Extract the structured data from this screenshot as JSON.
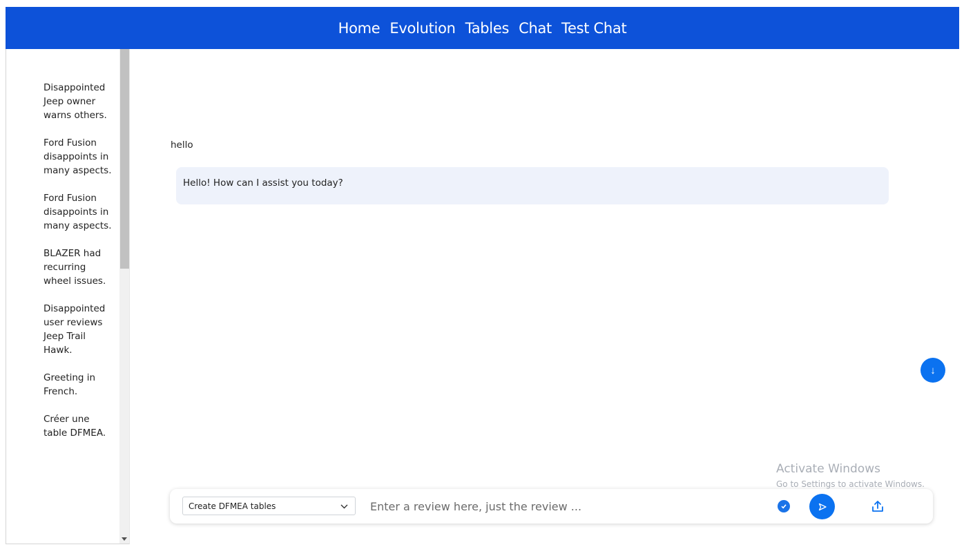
{
  "nav": {
    "links": [
      "Home",
      "Evolution",
      "Tables",
      "Chat",
      "Test Chat"
    ]
  },
  "sidebar": {
    "items": [
      "Disappointed Jeep owner warns others.",
      "Ford Fusion disappoints in many aspects.",
      "Ford Fusion disappoints in many aspects.",
      "BLAZER had recurring wheel issues.",
      "Disappointed user reviews Jeep Trail Hawk.",
      "Greeting in French.",
      "Créer une table DFMEA."
    ]
  },
  "chat": {
    "user_message": "hello",
    "bot_message": "Hello! How can I assist you today?",
    "scroll_down_icon": "arrow-down-icon",
    "scroll_down_glyph": "↓"
  },
  "watermark": {
    "title": "Activate Windows",
    "subtitle": "Go to Settings to activate Windows."
  },
  "composer": {
    "mode_selected": "Create DFMEA tables",
    "placeholder": "Enter a review here, just the review ..."
  },
  "colors": {
    "navbar": "#0d52d9",
    "accent": "#0b72f0",
    "bot_bubble": "#eef2fb"
  }
}
